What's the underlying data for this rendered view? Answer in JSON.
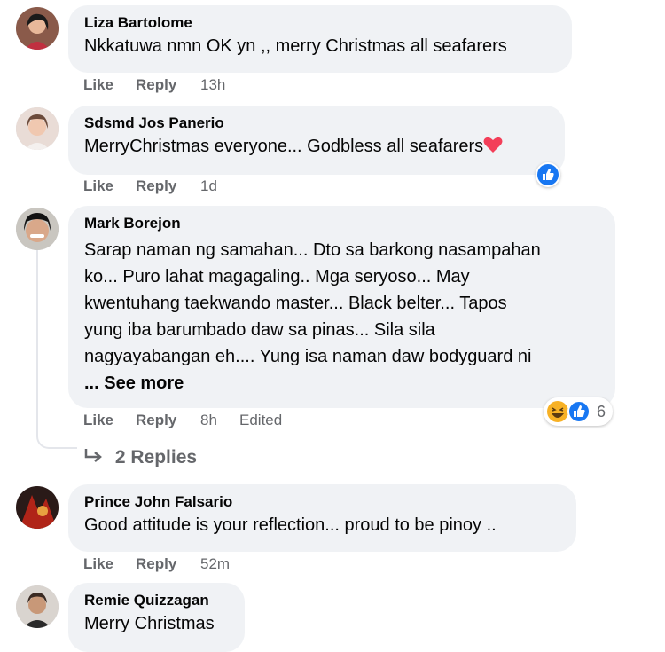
{
  "colors": {
    "bubble": "#f0f2f5",
    "meta": "#65676b",
    "like_blue": "#1877f2",
    "heart_red": "#f33e58",
    "haha_yellow": "#f7b125"
  },
  "comments": [
    {
      "author": "Liza Bartolome",
      "text": "Nkkatuwa nmn OK yn ,, merry Christmas all seafarers",
      "like": "Like",
      "reply": "Reply",
      "time": "13h"
    },
    {
      "author": "Sdsmd Jos Panerio",
      "text": "MerryChristmas everyone... Godbless all seafarers",
      "like": "Like",
      "reply": "Reply",
      "time": "1d",
      "reaction_icons": [
        "like-icon"
      ]
    },
    {
      "author": "Mark Borejon",
      "lines": [
        "Sarap naman ng samahan... Dto sa barkong nasampahan",
        "ko... Puro lahat magagaling.. Mga seryoso... May",
        "kwentuhang taekwando master... Black belter... Tapos",
        "yung iba barumbado daw sa pinas... Sila sila",
        "nagyayabangan eh.... Yung isa naman daw bodyguard ni"
      ],
      "see_more": "... See more",
      "like": "Like",
      "reply": "Reply",
      "time": "8h",
      "edited": "Edited",
      "reaction_icons": [
        "haha-icon",
        "like-icon"
      ],
      "reaction_count": "6",
      "replies": "2 Replies"
    },
    {
      "author": "Prince John Falsario",
      "text": "Good attitude is your reflection... proud to be pinoy ..",
      "like": "Like",
      "reply": "Reply",
      "time": "52m"
    },
    {
      "author": "Remie Quizzagan",
      "text": "Merry Christmas"
    }
  ]
}
